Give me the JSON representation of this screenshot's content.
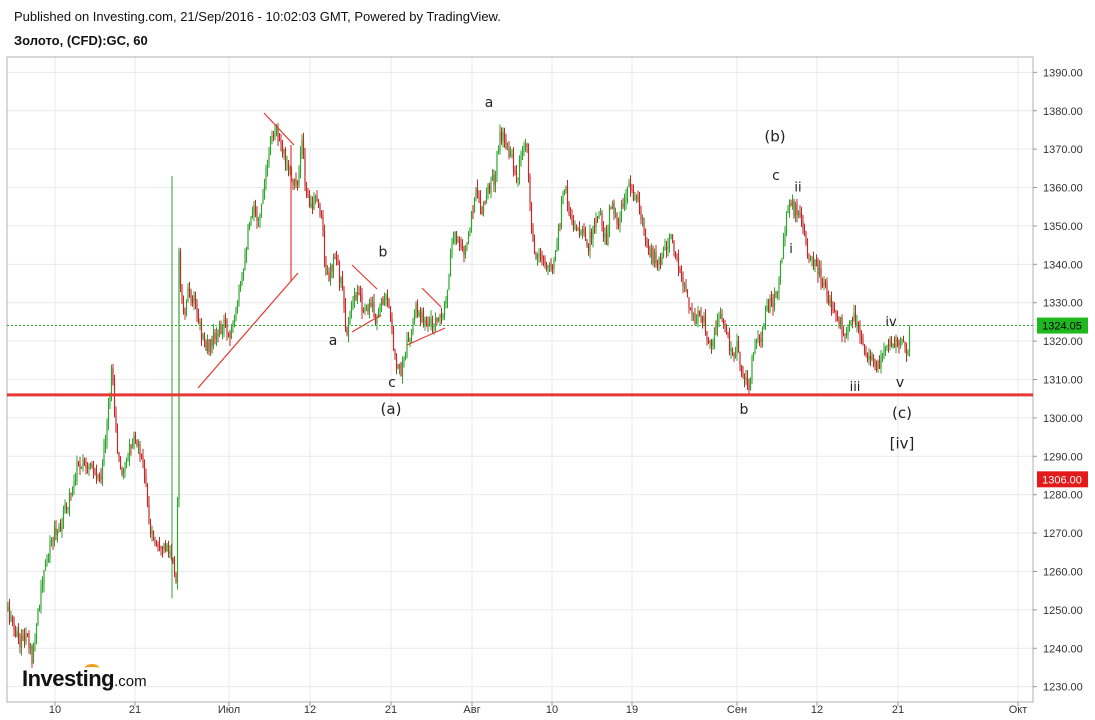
{
  "header": {
    "published": "Published on Investing.com, 21/Sep/2016 - 10:02:03 GMT, Powered by TradingView.",
    "symbol": "Золото, (CFD):GC, 60"
  },
  "logo": {
    "brand": "Investing",
    "suffix": ".com"
  },
  "colors": {
    "up": "#2ea52e",
    "down": "#c62828",
    "grid": "#e9e9e9",
    "support": "#e53935",
    "current_line": "#2eaa2e",
    "pattern": "#e53935"
  },
  "chart_data": {
    "type": "candlestick",
    "ylim": [
      1226,
      1394
    ],
    "y_ticks": [
      "1230.00",
      "1240.00",
      "1250.00",
      "1260.00",
      "1270.00",
      "1280.00",
      "1290.00",
      "1300.00",
      "1310.00",
      "1320.00",
      "1330.00",
      "1340.00",
      "1350.00",
      "1360.00",
      "1370.00",
      "1380.00",
      "1390.00"
    ],
    "x_ticks": [
      "10",
      "21",
      "Июл",
      "12",
      "21",
      "Авг",
      "10",
      "19",
      "Сен",
      "12",
      "21",
      "Окт"
    ],
    "current_price": {
      "value": 1324.05,
      "label": "1324.05"
    },
    "support_level": {
      "value": 1306.0,
      "label": "1306.00"
    },
    "price_path": [
      [
        0,
        1250
      ],
      [
        6,
        1245
      ],
      [
        12,
        1242
      ],
      [
        18,
        1243
      ],
      [
        24,
        1238
      ],
      [
        30,
        1250
      ],
      [
        38,
        1262
      ],
      [
        46,
        1270
      ],
      [
        54,
        1273
      ],
      [
        62,
        1280
      ],
      [
        70,
        1288
      ],
      [
        78,
        1289
      ],
      [
        86,
        1285
      ],
      [
        92,
        1284
      ],
      [
        98,
        1295
      ],
      [
        104,
        1314
      ],
      [
        108,
        1295
      ],
      [
        113,
        1285
      ],
      [
        118,
        1288
      ],
      [
        124,
        1295
      ],
      [
        130,
        1293
      ],
      [
        136,
        1288
      ],
      [
        141,
        1272
      ],
      [
        147,
        1268
      ],
      [
        153,
        1268
      ],
      [
        160,
        1265
      ],
      [
        165,
        1262
      ],
      [
        169,
        1257
      ],
      [
        171,
        1342
      ],
      [
        175,
        1325
      ],
      [
        180,
        1332
      ],
      [
        186,
        1330
      ],
      [
        192,
        1324
      ],
      [
        198,
        1318
      ],
      [
        204,
        1320
      ],
      [
        210,
        1322
      ],
      [
        216,
        1324
      ],
      [
        222,
        1322
      ],
      [
        228,
        1330
      ],
      [
        234,
        1338
      ],
      [
        240,
        1348
      ],
      [
        246,
        1354
      ],
      [
        252,
        1352
      ],
      [
        258,
        1366
      ],
      [
        264,
        1374
      ],
      [
        268,
        1376
      ],
      [
        272,
        1370
      ],
      [
        278,
        1368
      ],
      [
        284,
        1363
      ],
      [
        290,
        1360
      ],
      [
        294,
        1372
      ],
      [
        298,
        1358
      ],
      [
        304,
        1356
      ],
      [
        308,
        1356
      ],
      [
        314,
        1353
      ],
      [
        318,
        1336
      ],
      [
        323,
        1338
      ],
      [
        328,
        1342
      ],
      [
        333,
        1335
      ],
      [
        339,
        1322
      ],
      [
        345,
        1330
      ],
      [
        351,
        1332
      ],
      [
        356,
        1328
      ],
      [
        362,
        1330
      ],
      [
        368,
        1326
      ],
      [
        373,
        1330
      ],
      [
        378,
        1332
      ],
      [
        383,
        1324
      ],
      [
        388,
        1315
      ],
      [
        393,
        1312
      ],
      [
        398,
        1318
      ],
      [
        403,
        1322
      ],
      [
        408,
        1328
      ],
      [
        414,
        1326
      ],
      [
        420,
        1325
      ],
      [
        426,
        1324
      ],
      [
        432,
        1327
      ],
      [
        438,
        1330
      ],
      [
        444,
        1345
      ],
      [
        450,
        1348
      ],
      [
        456,
        1342
      ],
      [
        462,
        1350
      ],
      [
        468,
        1360
      ],
      [
        474,
        1355
      ],
      [
        480,
        1360
      ],
      [
        486,
        1362
      ],
      [
        492,
        1374
      ],
      [
        498,
        1372
      ],
      [
        504,
        1368
      ],
      [
        508,
        1360
      ],
      [
        513,
        1368
      ],
      [
        519,
        1370
      ],
      [
        523,
        1350
      ],
      [
        528,
        1340
      ],
      [
        533,
        1343
      ],
      [
        539,
        1338
      ],
      [
        545,
        1340
      ],
      [
        551,
        1350
      ],
      [
        557,
        1362
      ],
      [
        562,
        1352
      ],
      [
        568,
        1350
      ],
      [
        574,
        1348
      ],
      [
        580,
        1345
      ],
      [
        586,
        1350
      ],
      [
        592,
        1352
      ],
      [
        598,
        1346
      ],
      [
        603,
        1356
      ],
      [
        609,
        1350
      ],
      [
        615,
        1355
      ],
      [
        621,
        1360
      ],
      [
        627,
        1358
      ],
      [
        633,
        1352
      ],
      [
        639,
        1344
      ],
      [
        645,
        1342
      ],
      [
        651,
        1340
      ],
      [
        657,
        1345
      ],
      [
        663,
        1346
      ],
      [
        669,
        1340
      ],
      [
        675,
        1336
      ],
      [
        681,
        1330
      ],
      [
        687,
        1325
      ],
      [
        693,
        1327
      ],
      [
        699,
        1322
      ],
      [
        705,
        1320
      ],
      [
        711,
        1326
      ],
      [
        717,
        1325
      ],
      [
        723,
        1316
      ],
      [
        729,
        1318
      ],
      [
        735,
        1312
      ],
      [
        741,
        1308
      ],
      [
        746,
        1318
      ],
      [
        752,
        1320
      ],
      [
        757,
        1328
      ],
      [
        763,
        1330
      ],
      [
        769,
        1332
      ],
      [
        775,
        1345
      ],
      [
        781,
        1356
      ],
      [
        787,
        1354
      ],
      [
        793,
        1352
      ],
      [
        799,
        1343
      ],
      [
        805,
        1340
      ],
      [
        811,
        1338
      ],
      [
        817,
        1334
      ],
      [
        823,
        1330
      ],
      [
        829,
        1328
      ],
      [
        835,
        1322
      ],
      [
        841,
        1324
      ],
      [
        847,
        1326
      ],
      [
        853,
        1322
      ],
      [
        859,
        1316
      ],
      [
        865,
        1315
      ],
      [
        871,
        1313
      ],
      [
        877,
        1318
      ],
      [
        883,
        1320
      ],
      [
        889,
        1319
      ],
      [
        895,
        1322
      ],
      [
        899,
        1316
      ],
      [
        902,
        1324
      ]
    ],
    "annotations": [
      {
        "text": "a",
        "px": 489,
        "price": 1381,
        "size": 14
      },
      {
        "text": "(b)",
        "px": 775,
        "price": 1372,
        "size": 15
      },
      {
        "text": "c",
        "px": 776,
        "price": 1362,
        "size": 14
      },
      {
        "text": "ii",
        "px": 798,
        "price": 1359,
        "size": 13
      },
      {
        "text": "i",
        "px": 791,
        "price": 1343,
        "size": 13
      },
      {
        "text": "b",
        "px": 383,
        "price": 1342,
        "size": 14
      },
      {
        "text": "a",
        "px": 333,
        "price": 1319,
        "size": 14
      },
      {
        "text": "c",
        "px": 392,
        "price": 1308,
        "size": 14
      },
      {
        "text": "(a)",
        "px": 391,
        "price": 1301,
        "size": 15
      },
      {
        "text": "b",
        "px": 744,
        "price": 1301,
        "size": 14
      },
      {
        "text": "iv",
        "px": 891,
        "price": 1324,
        "size": 13
      },
      {
        "text": "iii",
        "px": 855,
        "price": 1307,
        "size": 13
      },
      {
        "text": "v",
        "px": 900,
        "price": 1308,
        "size": 14
      },
      {
        "text": "(c)",
        "px": 902,
        "price": 1300,
        "size": 15
      },
      {
        "text": "[iv]",
        "px": 902,
        "price": 1292,
        "size": 15
      }
    ]
  }
}
